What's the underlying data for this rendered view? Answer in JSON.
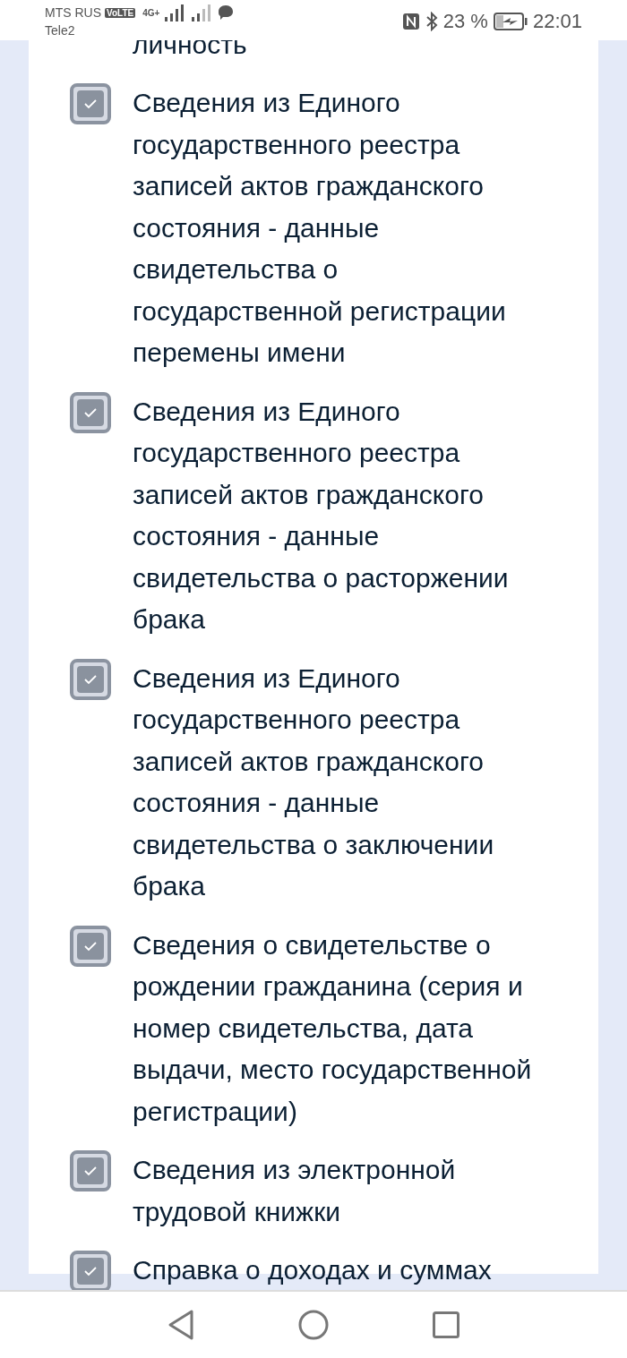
{
  "status_bar": {
    "carrier_1": "MTS RUS",
    "volte": "VoLTE",
    "carrier_2": "Tele2",
    "network": "4G+",
    "battery": "23 %",
    "time": "22:01"
  },
  "cut_text": "личность",
  "items": [
    {
      "text": "Сведения из Единого государственного реестра записей актов гражданского состояния - данные свидетельства о государственной регистрации перемены имени",
      "checked": true
    },
    {
      "text": "Сведения из Единого государственного реестра записей актов гражданского состояния - данные свидетельства о расторжении брака",
      "checked": true
    },
    {
      "text": "Сведения из Единого государственного реестра записей актов гражданского состояния - данные свидетельства о заключении брака",
      "checked": true
    },
    {
      "text": "Сведения о свидетельстве о рождении гражданина (серия и номер свидетельства, дата выдачи, место государственной регистрации)",
      "checked": true
    },
    {
      "text": "Сведения из электронной трудовой книжки",
      "checked": true
    },
    {
      "text": "Справка о доходах и суммах",
      "checked": true
    }
  ]
}
